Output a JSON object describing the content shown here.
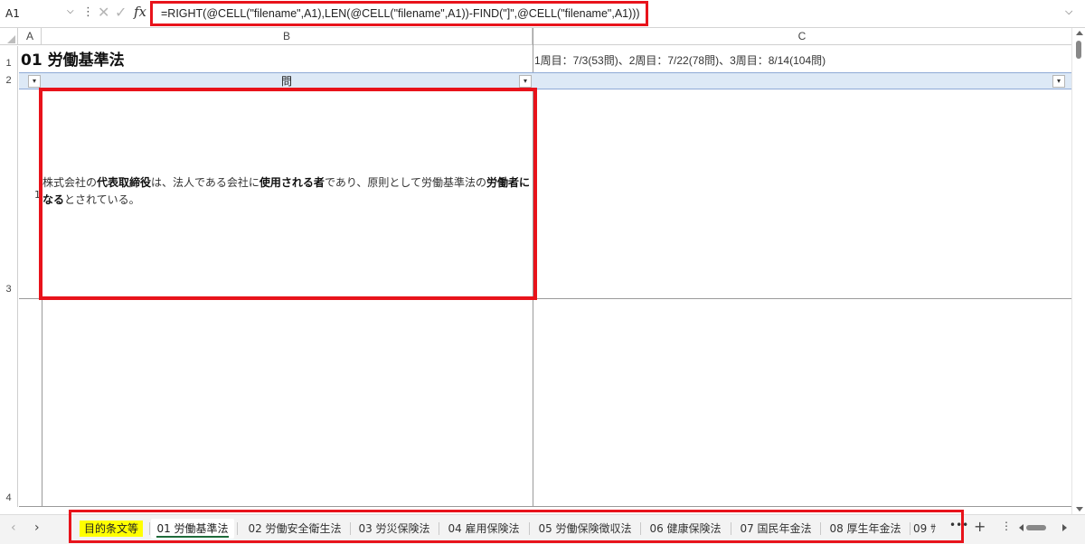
{
  "formula_bar": {
    "name_box": "A1",
    "formula": "=RIGHT(@CELL(\"filename\",A1),LEN(@CELL(\"filename\",A1))-FIND(\"]\",@CELL(\"filename\",A1)))",
    "fx_label": "fx"
  },
  "columns": [
    "A",
    "B",
    "C"
  ],
  "rows": [
    "1",
    "2",
    "3",
    "4"
  ],
  "cells": {
    "a1_title": "01 労働基準法",
    "c1_note": "1周目：7/3(53問)、2周目：7/22(78問)、3周目：8/14(104問)",
    "b2_header": "問",
    "a3_number": "1",
    "b3_question_parts": [
      "株式会社の",
      "代表取締役",
      "は、法人である会社に",
      "使用される者",
      "であり、原則として労働基準法の",
      "労働者になる",
      "とされている。"
    ]
  },
  "sheet_tabs": [
    {
      "label": "目的条文等",
      "highlight": "#ffff00"
    },
    {
      "label": "01 労働基準法",
      "active": true
    },
    {
      "label": "02 労働安全衛生法"
    },
    {
      "label": "03 労災保険法"
    },
    {
      "label": "04 雇用保険法"
    },
    {
      "label": "05 労働保険徴収法"
    },
    {
      "label": "06 健康保険法"
    },
    {
      "label": "07 国民年金法"
    },
    {
      "label": "08 厚生年金法"
    },
    {
      "label": "09 ｻ"
    }
  ],
  "tab_controls": {
    "more": "•••",
    "add": "+",
    "menu": "⋮"
  },
  "colors": {
    "highlight_red": "#e8131b",
    "active_tab": "#1d6b3a",
    "header_band": "#dde9f6"
  }
}
